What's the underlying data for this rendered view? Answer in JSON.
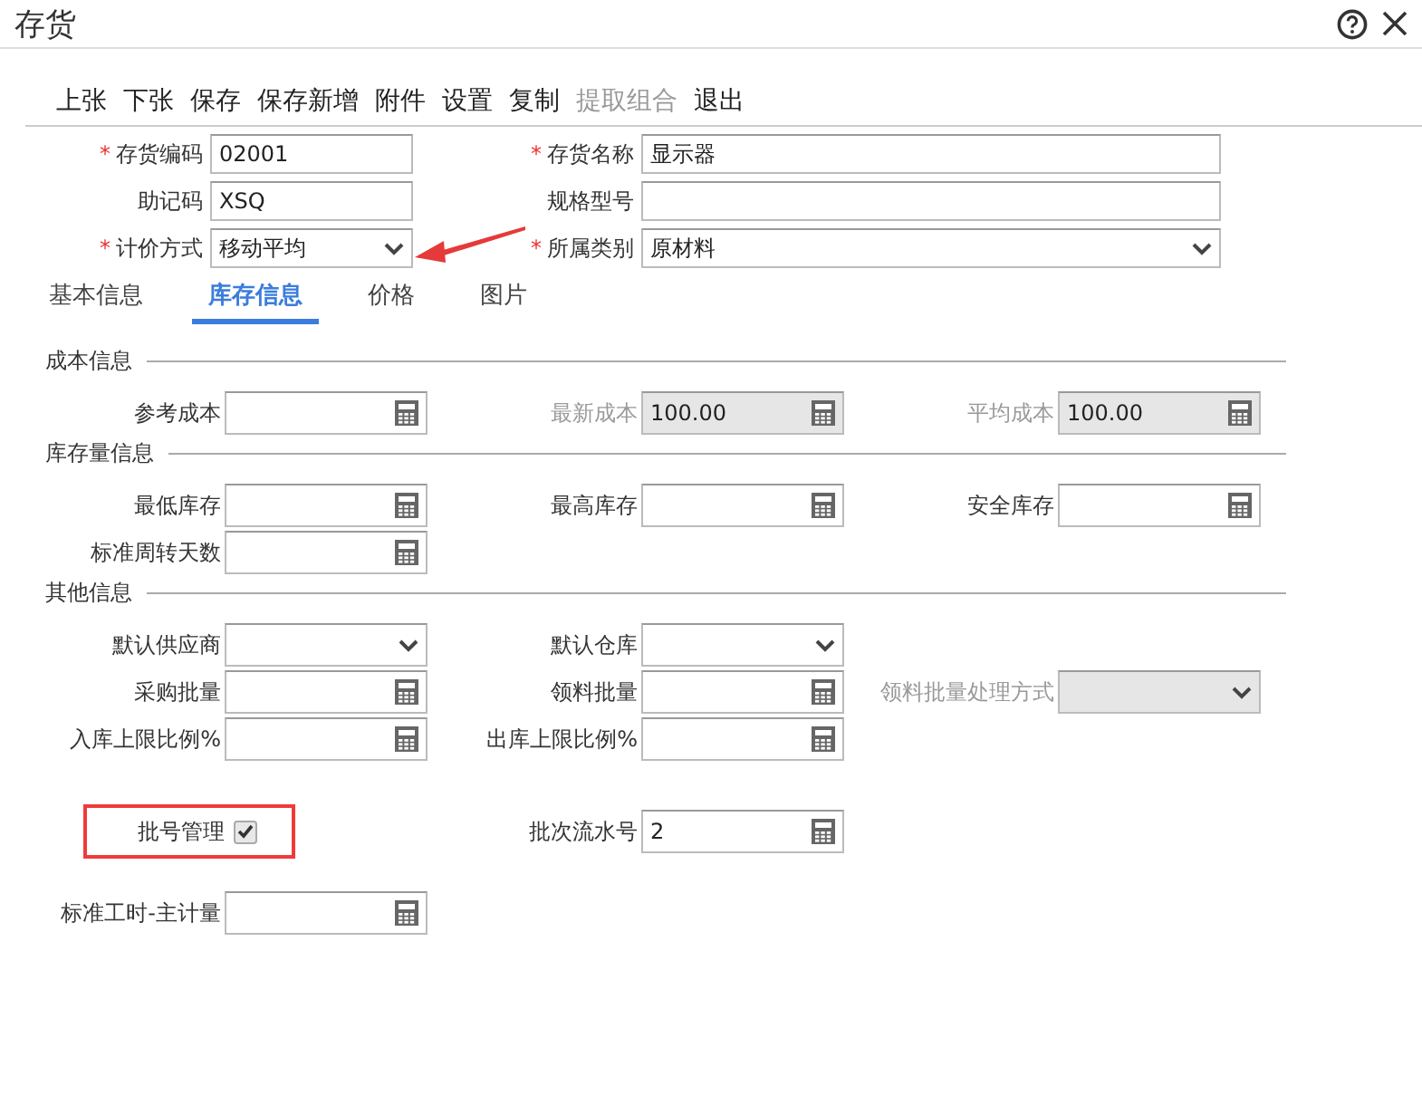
{
  "window": {
    "title": "存货"
  },
  "toolbar": [
    {
      "label": "上张",
      "disabled": false
    },
    {
      "label": "下张",
      "disabled": false
    },
    {
      "label": "保存",
      "disabled": false
    },
    {
      "label": "保存新增",
      "disabled": false
    },
    {
      "label": "附件",
      "disabled": false
    },
    {
      "label": "设置",
      "disabled": false
    },
    {
      "label": "复制",
      "disabled": false
    },
    {
      "label": "提取组合",
      "disabled": true
    },
    {
      "label": "退出",
      "disabled": false
    }
  ],
  "header_fields": [
    {
      "label": "存货编码",
      "required_mark": "*",
      "kind": "text",
      "value": "02001"
    },
    {
      "label": "存货名称",
      "required_mark": "*",
      "kind": "text",
      "value": "显示器"
    },
    {
      "label": "助记码",
      "kind": "text",
      "value": "XSQ"
    },
    {
      "label": "规格型号",
      "kind": "text"
    },
    {
      "label": "计价方式",
      "required_mark": "*",
      "kind": "select",
      "value": "移动平均"
    },
    {
      "label": "所属类别",
      "required_mark": "*",
      "kind": "select",
      "value": "原材料"
    }
  ],
  "tabs": [
    {
      "label": "基本信息",
      "selected": false
    },
    {
      "label": "库存信息",
      "selected": true
    },
    {
      "label": "价格",
      "selected": false
    },
    {
      "label": "图片",
      "selected": false
    }
  ],
  "sections": [
    {
      "title": "成本信息",
      "rows": [
        [
          {
            "label": "参考成本",
            "kind": "calc",
            "disabled": false
          },
          {
            "label": "最新成本",
            "kind": "calc",
            "disabled": true,
            "value": "100.00"
          },
          {
            "label": "平均成本",
            "kind": "calc",
            "disabled": true,
            "value": "100.00"
          }
        ]
      ]
    },
    {
      "title": "库存量信息",
      "rows": [
        [
          {
            "label": "最低库存",
            "kind": "calc",
            "disabled": false
          },
          {
            "label": "最高库存",
            "kind": "calc",
            "disabled": false
          },
          {
            "label": "安全库存",
            "kind": "calc",
            "disabled": false
          }
        ],
        [
          {
            "label": "标准周转天数",
            "kind": "calc",
            "disabled": false
          }
        ]
      ]
    },
    {
      "title": "其他信息",
      "rows": [
        [
          {
            "label": "默认供应商",
            "kind": "select",
            "disabled": false
          },
          {
            "label": "默认仓库",
            "kind": "select",
            "disabled": false
          }
        ],
        [
          {
            "label": "采购批量",
            "kind": "calc",
            "disabled": false
          },
          {
            "label": "领料批量",
            "kind": "calc",
            "disabled": false
          },
          {
            "label": "领料批量处理方式",
            "kind": "select",
            "disabled": true
          }
        ],
        [
          {
            "label": "入库上限比例%",
            "kind": "calc",
            "disabled": false
          },
          {
            "label": "出库上限比例%",
            "kind": "calc",
            "disabled": false
          }
        ],
        [
          {
            "label": "批号管理",
            "kind": "checkbox",
            "checked": true,
            "highlighted": true
          },
          {
            "label": "批次流水号",
            "kind": "calc",
            "disabled": false,
            "value": "2"
          }
        ],
        [
          {
            "label": "标准工时-主计量",
            "kind": "calc",
            "disabled": false
          }
        ]
      ]
    }
  ]
}
